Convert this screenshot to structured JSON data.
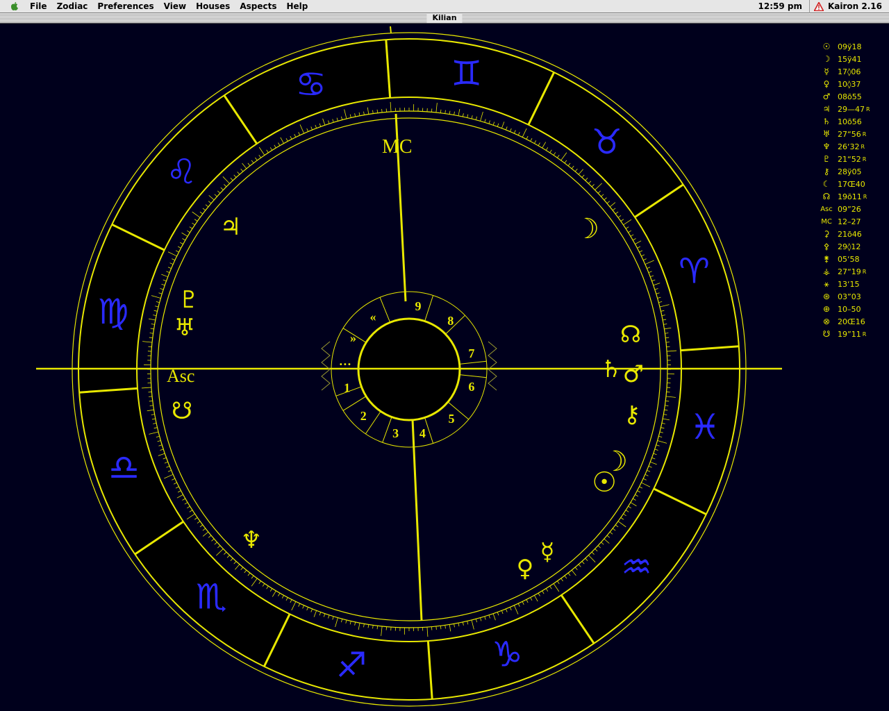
{
  "menubar": {
    "items": [
      "File",
      "Zodiac",
      "Preferences",
      "View",
      "Houses",
      "Aspects",
      "Help"
    ],
    "clock": "12:59 pm",
    "app_name": "Kairon 2.16"
  },
  "window": {
    "title": "Kilian"
  },
  "colors": {
    "background": "#00001c",
    "ring_yellow": "#e8e800",
    "sign_blue": "#2a2aff",
    "aspect_red": "#a01818",
    "aspect_orange": "#c05000",
    "aspect_blue": "#3a78d8",
    "aspect_yellow": "#a8a830"
  },
  "chart": {
    "zodiac_signs": [
      {
        "name": "aries",
        "glyph": "♈"
      },
      {
        "name": "taurus",
        "glyph": "♉"
      },
      {
        "name": "gemini",
        "glyph": "♊"
      },
      {
        "name": "cancer",
        "glyph": "♋"
      },
      {
        "name": "leo",
        "glyph": "♌"
      },
      {
        "name": "virgo",
        "glyph": "♍"
      },
      {
        "name": "libra",
        "glyph": "♎"
      },
      {
        "name": "scorpio",
        "glyph": "♏"
      },
      {
        "name": "sagittarius",
        "glyph": "♐"
      },
      {
        "name": "capricorn",
        "glyph": "♑"
      },
      {
        "name": "aquarius",
        "glyph": "♒"
      },
      {
        "name": "pisces",
        "glyph": "♓"
      }
    ],
    "angle_labels": {
      "asc": "Asc",
      "mc": "MC"
    },
    "house_numbers": [
      "1",
      "2",
      "3",
      "4",
      "5",
      "6",
      "7",
      "8",
      "9",
      "…",
      "»",
      "«"
    ],
    "planets": [
      {
        "name": "sun",
        "glyph": "☉"
      },
      {
        "name": "moon",
        "glyph": "☽"
      },
      {
        "name": "moon-second",
        "glyph": "☽"
      },
      {
        "name": "mercury",
        "glyph": "☿"
      },
      {
        "name": "venus",
        "glyph": "♀"
      },
      {
        "name": "mars",
        "glyph": "♂"
      },
      {
        "name": "jupiter",
        "glyph": "♃"
      },
      {
        "name": "saturn",
        "glyph": "♄"
      },
      {
        "name": "uranus",
        "glyph": "♅"
      },
      {
        "name": "neptune",
        "glyph": "♆"
      },
      {
        "name": "pluto",
        "glyph": "♇"
      },
      {
        "name": "chiron",
        "glyph": "⚷"
      },
      {
        "name": "north-node",
        "glyph": "☊"
      },
      {
        "name": "south-node",
        "glyph": "☋"
      }
    ]
  },
  "positions": [
    {
      "name": "sun",
      "glyph": "☉",
      "value": "09ÿ18"
    },
    {
      "name": "moon",
      "glyph": "☽",
      "value": "15ÿ41"
    },
    {
      "name": "mercury",
      "glyph": "☿",
      "value": "17◊06"
    },
    {
      "name": "venus",
      "glyph": "♀",
      "value": "10◊37"
    },
    {
      "name": "mars",
      "glyph": "♂",
      "value": "08õ55"
    },
    {
      "name": "jupiter",
      "glyph": "♃",
      "value": "29—47",
      "retro": "R"
    },
    {
      "name": "saturn",
      "glyph": "♄",
      "value": "10õ56"
    },
    {
      "name": "uranus",
      "glyph": "♅",
      "value": "27“56",
      "retro": "R"
    },
    {
      "name": "neptune",
      "glyph": "♆",
      "value": "26‘32",
      "retro": "R"
    },
    {
      "name": "pluto",
      "glyph": "♇",
      "value": "21“52",
      "retro": "R"
    },
    {
      "name": "chiron",
      "glyph": "⚷",
      "value": "28ÿ05"
    },
    {
      "name": "lilith",
      "glyph": "☾",
      "value": "17Œ40"
    },
    {
      "name": "node",
      "glyph": "☊",
      "value": "19õ11",
      "retro": "R"
    },
    {
      "name": "asc",
      "glyph": "Asc",
      "value": "09”26"
    },
    {
      "name": "mc",
      "glyph": "MC",
      "value": "12–27"
    },
    {
      "name": "ceres",
      "glyph": "⚳",
      "value": "21õ46"
    },
    {
      "name": "pallas",
      "glyph": "⚴",
      "value": "29◊12"
    },
    {
      "name": "juno",
      "glyph": "⚵",
      "value": "05‘58"
    },
    {
      "name": "vesta",
      "glyph": "⚶",
      "value": "27“19",
      "retro": "R"
    },
    {
      "name": "point-a",
      "glyph": "⚹",
      "value": "13‘15"
    },
    {
      "name": "point-b",
      "glyph": "⊛",
      "value": "03”03"
    },
    {
      "name": "point-c",
      "glyph": "⊕",
      "value": "10–50"
    },
    {
      "name": "point-d",
      "glyph": "⊗",
      "value": "20Œ16"
    },
    {
      "name": "south-node",
      "glyph": "☋",
      "value": "19”11",
      "retro": "R"
    }
  ]
}
